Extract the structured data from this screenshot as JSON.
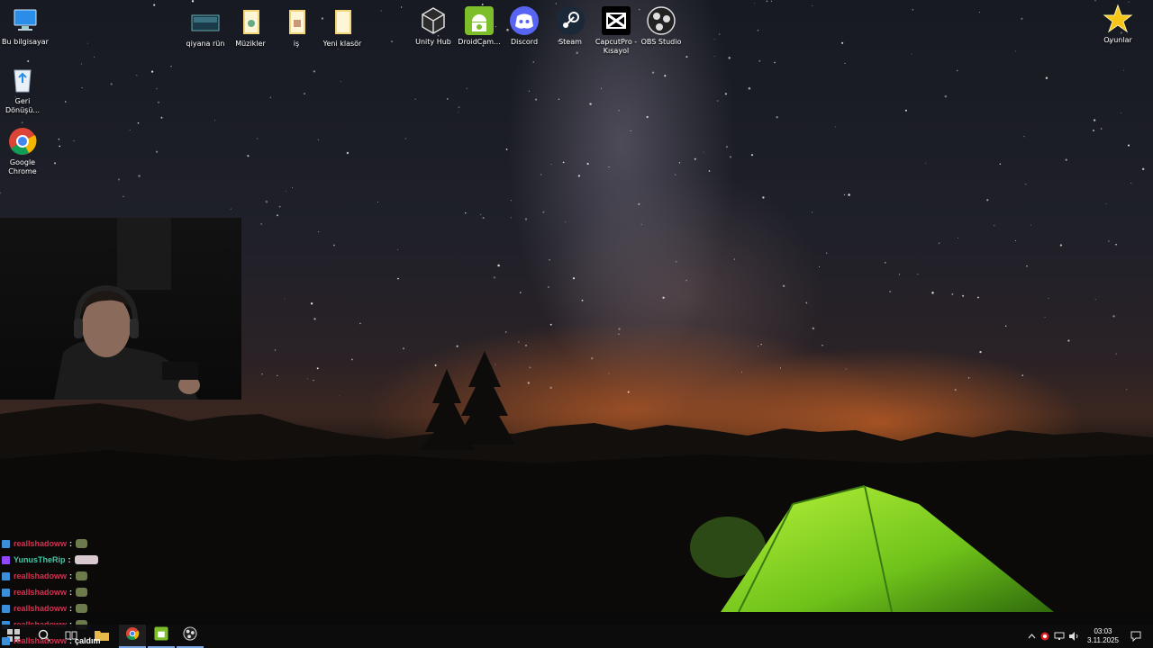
{
  "desktop_icons": [
    {
      "label": "Bu bilgisayar",
      "icon": "this-pc-icon"
    },
    {
      "label": "Geri Dönüşü...",
      "icon": "recycle-bin-icon"
    },
    {
      "label": "Google Chrome",
      "icon": "chrome-icon"
    },
    {
      "label": "qiyana rün",
      "icon": "image-file-icon"
    },
    {
      "label": "Müzikler",
      "icon": "folder-icon"
    },
    {
      "label": "iş",
      "icon": "folder-icon"
    },
    {
      "label": "Yeni klasör",
      "icon": "folder-icon"
    },
    {
      "label": "Unity Hub",
      "icon": "unity-icon"
    },
    {
      "label": "DroidCam...",
      "icon": "droidcam-icon"
    },
    {
      "label": "Discord",
      "icon": "discord-icon"
    },
    {
      "label": "Steam",
      "icon": "steam-icon"
    },
    {
      "label": "CapcutPro - Kısayol",
      "icon": "capcut-icon"
    },
    {
      "label": "OBS Studio",
      "icon": "obs-icon"
    },
    {
      "label": "Oyunlar",
      "icon": "star-icon"
    }
  ],
  "chat": [
    {
      "user": "reallshadoww",
      "sep": ":",
      "message": "",
      "user_color": "#d9304f"
    },
    {
      "user": "YunusTheRip",
      "sep": ":",
      "message": "",
      "user_color": "#46c7a8"
    },
    {
      "user": "reallshadoww",
      "sep": ":",
      "message": "",
      "user_color": "#d9304f"
    },
    {
      "user": "reallshadoww",
      "sep": ":",
      "message": "",
      "user_color": "#d9304f"
    },
    {
      "user": "reallshadoww",
      "sep": ":",
      "message": "",
      "user_color": "#d9304f"
    },
    {
      "user": "reallshadoww",
      "sep": ":",
      "message": "",
      "user_color": "#d9304f"
    },
    {
      "user": "reallshadoww",
      "sep": ":",
      "message": "çaldım",
      "user_color": "#d9304f"
    }
  ],
  "taskbar": {
    "icons": [
      "start-icon",
      "search-icon",
      "task-view-icon",
      "file-explorer-icon",
      "chrome-icon",
      "droidcam-icon",
      "obs-icon"
    ]
  },
  "tray": {
    "time": "03:03",
    "date": "3.11.2025",
    "icons": [
      "chevron-up-icon",
      "recording-icon",
      "network-icon",
      "volume-icon",
      "notification-icon"
    ]
  }
}
